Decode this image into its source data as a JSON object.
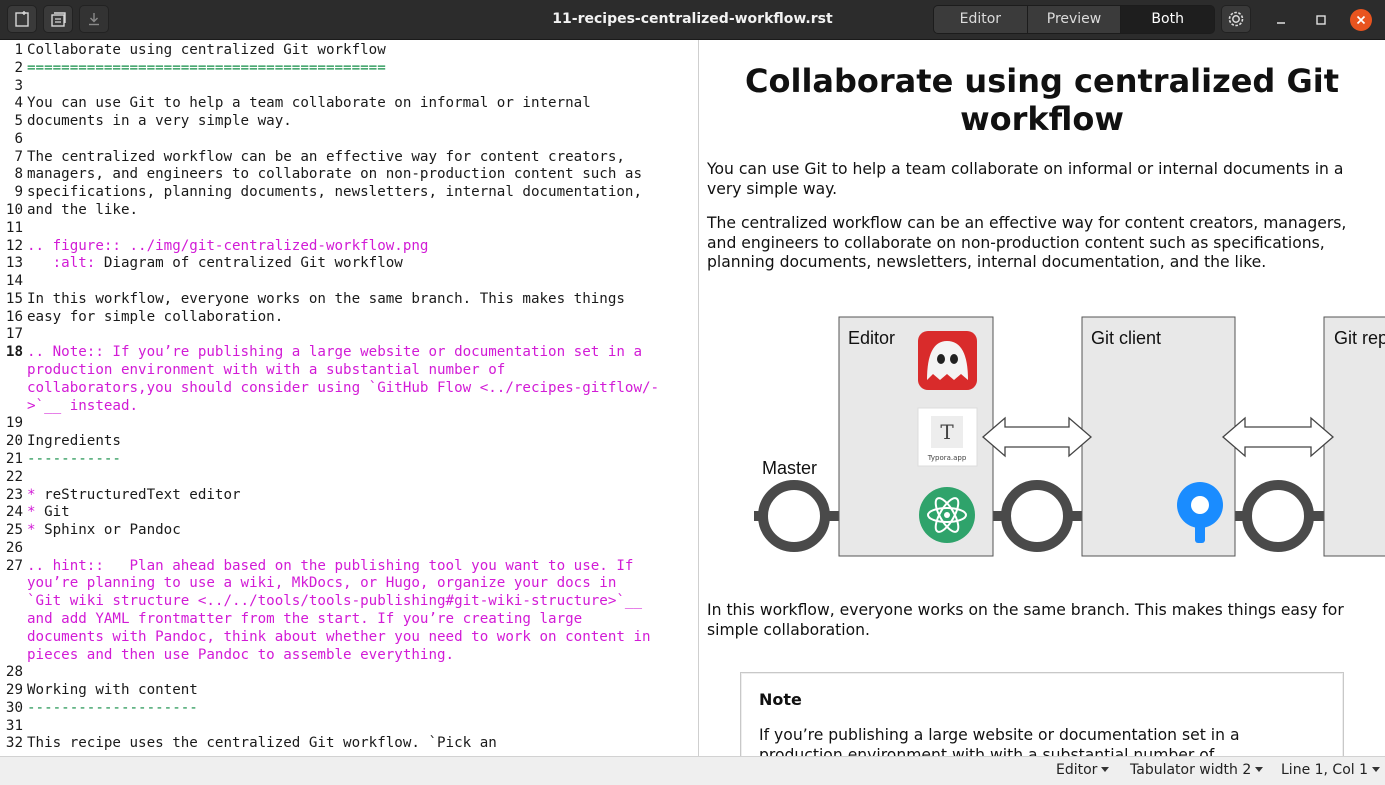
{
  "window": {
    "title": "11-recipes-centralized-workflow.rst",
    "view_modes": [
      "Editor",
      "Preview",
      "Both"
    ],
    "active_mode": "Both"
  },
  "editor": {
    "lines": [
      {
        "n": "1",
        "t": "Collaborate using centralized Git workflow",
        "c": ""
      },
      {
        "n": "2",
        "t": "==========================================",
        "c": "green"
      },
      {
        "n": "3",
        "t": "",
        "c": ""
      },
      {
        "n": "4",
        "t": "You can use Git to help a team collaborate on informal or internal",
        "c": ""
      },
      {
        "n": "5",
        "t": "documents in a very simple way.",
        "c": ""
      },
      {
        "n": "6",
        "t": "",
        "c": ""
      },
      {
        "n": "7",
        "t": "The centralized workflow can be an effective way for content creators,",
        "c": ""
      },
      {
        "n": "8",
        "t": "managers, and engineers to collaborate on non-production content such as",
        "c": ""
      },
      {
        "n": "9",
        "t": "specifications, planning documents, newsletters, internal documentation,",
        "c": ""
      },
      {
        "n": "10",
        "t": "and the like.",
        "c": ""
      },
      {
        "n": "11",
        "t": "",
        "c": ""
      },
      {
        "n": "12",
        "t": ".. figure:: ../img/git-centralized-workflow.png",
        "c": "mag"
      },
      {
        "n": "13",
        "t": "   :alt: Diagram of centralized Git workflow",
        "c": "alt"
      },
      {
        "n": "14",
        "t": "",
        "c": ""
      },
      {
        "n": "15",
        "t": "In this workflow, everyone works on the same branch. This makes things",
        "c": ""
      },
      {
        "n": "16",
        "t": "easy for simple collaboration.",
        "c": ""
      },
      {
        "n": "17",
        "t": "",
        "c": ""
      },
      {
        "n": "18",
        "t": ".. Note:: If you’re publishing a large website or documentation set in a",
        "c": "mag",
        "bold": true
      },
      {
        "n": "",
        "t": "production environment with with a substantial number of",
        "c": "mag"
      },
      {
        "n": "",
        "t": "collaborators,you should consider using `GitHub Flow <../recipes-gitflow/-",
        "c": "mag"
      },
      {
        "n": "",
        "t": ">`__ instead.",
        "c": "mag"
      },
      {
        "n": "19",
        "t": "",
        "c": ""
      },
      {
        "n": "20",
        "t": "Ingredients",
        "c": ""
      },
      {
        "n": "21",
        "t": "-----------",
        "c": "green"
      },
      {
        "n": "22",
        "t": "",
        "c": ""
      },
      {
        "n": "23",
        "t": "* reStructuredText editor",
        "c": "bullet"
      },
      {
        "n": "24",
        "t": "* Git",
        "c": "bullet"
      },
      {
        "n": "25",
        "t": "* Sphinx or Pandoc",
        "c": "bullet"
      },
      {
        "n": "26",
        "t": "",
        "c": ""
      },
      {
        "n": "27",
        "t": ".. hint::   Plan ahead based on the publishing tool you want to use. If",
        "c": "mag"
      },
      {
        "n": "",
        "t": "you’re planning to use a wiki, MkDocs, or Hugo, organize your docs in",
        "c": "mag"
      },
      {
        "n": "",
        "t": "`Git wiki structure <../../tools/tools-publishing#git-wiki-structure>`__",
        "c": "mag"
      },
      {
        "n": "",
        "t": "and add YAML frontmatter from the start. If you’re creating large",
        "c": "mag"
      },
      {
        "n": "",
        "t": "documents with Pandoc, think about whether you need to work on content in",
        "c": "mag"
      },
      {
        "n": "",
        "t": "pieces and then use Pandoc to assemble everything.",
        "c": "mag"
      },
      {
        "n": "28",
        "t": "",
        "c": ""
      },
      {
        "n": "29",
        "t": "Working with content",
        "c": ""
      },
      {
        "n": "30",
        "t": "--------------------",
        "c": "green"
      },
      {
        "n": "31",
        "t": "",
        "c": ""
      },
      {
        "n": "32",
        "t": "This recipe uses the centralized Git workflow. `Pick an",
        "c": ""
      }
    ]
  },
  "preview": {
    "h1": "Collaborate using centralized Git workflow",
    "p1": "You can use Git to help a team collaborate on informal or internal documents in a very simple way.",
    "p2": "The centralized workflow can be an effective way for content creators, managers, and engineers to collaborate on non-production content such as specifications, planning documents, newsletters, internal documentation, and the like.",
    "diagram": {
      "master_label": "Master",
      "editor_label": "Editor",
      "git_client_label": "Git client",
      "git_repo_label": "Git rep",
      "typora_letter": "T",
      "typora_caption": "Typora.app"
    },
    "p3": "In this workflow, everyone works on the same branch. This makes things easy for simple collaboration.",
    "note_title": "Note",
    "note_body": "If you’re publishing a large website or documentation set in a production environment with with a substantial number of"
  },
  "status": {
    "mode": "Editor",
    "tab_width": "Tabulator width 2",
    "position": "Line 1, Col 1"
  },
  "colors": {
    "header_bg": "#2c2c2c",
    "heading_underline": "#128d46",
    "directive": "#d21bd6",
    "close_button": "#e9541f",
    "git_client_icon": "#1a8cff",
    "atom_icon": "#2fa36b"
  }
}
